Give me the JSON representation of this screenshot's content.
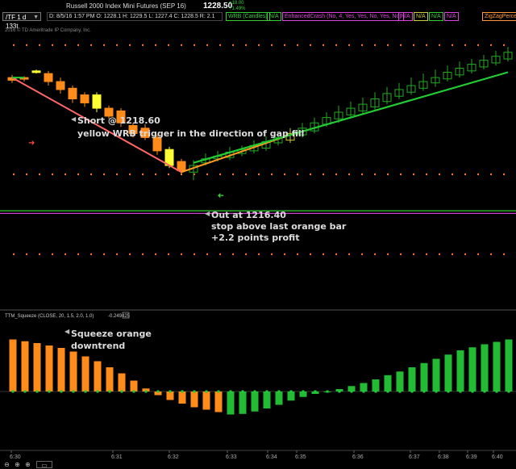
{
  "header": {
    "title_main": "Russell 2000 Index Mini Futures (SEP 16)",
    "last_price": "1228.50",
    "change": "+18.00",
    "change_pct": "+1.49%",
    "symbol": "/TF",
    "timeframe": "/TF 1 d 133t",
    "ohlc": "D: 8/5/16 1:57 PM   O: 1228.1   H: 1229.5   L: 1227.4   C: 1228.5   R: 2.1",
    "studies": [
      {
        "label": "WRB (Candles)",
        "color": "#33cc33"
      },
      {
        "label": "N/A",
        "color": "#33cc33"
      },
      {
        "label": "EnhancedCrash (No, 4, Yes, Yes, No, Yes, No)",
        "color": "#e040e0"
      },
      {
        "label": "N/A",
        "color": "#e040e0"
      },
      {
        "label": "N/A",
        "color": "#cccc33"
      },
      {
        "label": "N/A",
        "color": "#33cc33"
      },
      {
        "label": "N/A",
        "color": "#e040e0"
      },
      {
        "label": "ZigZagPerce",
        "color": "#ff9933"
      }
    ],
    "copyright": "2016 © TD Ameritrade IP Company, Inc."
  },
  "annotations": {
    "short": "Short @ 1218.60",
    "wrb": "yellow WRB trigger in the direction of gap fill",
    "out": "Out at 1216.40",
    "stop": "stop above last orange bar",
    "profit": "+2.2 points profit",
    "squeeze": "Squeeze orange",
    "downtrend": "downtrend"
  },
  "lower_panel": {
    "label": "TTM_Squeeze (CLOSE, 20, 1.5, 2.0, 1.0)",
    "value": "-0.249425"
  },
  "time_axis": [
    "6:30",
    "6:31",
    "6:32",
    "6:33",
    "6:34",
    "6:35",
    "6:36",
    "6:37",
    "6:38",
    "6:39",
    "6:40"
  ],
  "icons": [
    "zoom-out-icon",
    "search-icon",
    "zoom-in-icon",
    "menu-icon"
  ],
  "colors": {
    "orange": "#ff8c1a",
    "yellow": "#ffff33",
    "green": "#22bb33",
    "zigzag_down": "#ff6666",
    "zigzag_up": "#ff9922",
    "dots": "#ff7733"
  },
  "chart_data": {
    "type": "candlestick",
    "upper": {
      "candles": [
        {
          "o": 0.82,
          "c": 0.83,
          "h": 0.84,
          "l": 0.81,
          "t": "flat"
        },
        {
          "o": 0.825,
          "c": 0.83,
          "h": 0.835,
          "l": 0.815,
          "t": "flat"
        },
        {
          "o": 0.855,
          "c": 0.85,
          "h": 0.86,
          "l": 0.845,
          "t": "yellow"
        },
        {
          "o": 0.845,
          "c": 0.815,
          "h": 0.855,
          "l": 0.8,
          "t": "orange"
        },
        {
          "o": 0.815,
          "c": 0.785,
          "h": 0.83,
          "l": 0.77,
          "t": "orange"
        },
        {
          "o": 0.79,
          "c": 0.75,
          "h": 0.8,
          "l": 0.735,
          "t": "orange"
        },
        {
          "o": 0.765,
          "c": 0.735,
          "h": 0.775,
          "l": 0.72,
          "t": "flat"
        },
        {
          "o": 0.765,
          "c": 0.715,
          "h": 0.775,
          "l": 0.7,
          "t": "yellow"
        },
        {
          "o": 0.715,
          "c": 0.685,
          "h": 0.725,
          "l": 0.675,
          "t": "orange"
        },
        {
          "o": 0.705,
          "c": 0.66,
          "h": 0.715,
          "l": 0.645,
          "t": "orange"
        },
        {
          "o": 0.65,
          "c": 0.62,
          "h": 0.66,
          "l": 0.605,
          "t": "orange"
        },
        {
          "o": 0.64,
          "c": 0.605,
          "h": 0.655,
          "l": 0.595,
          "t": "orange"
        },
        {
          "o": 0.605,
          "c": 0.555,
          "h": 0.615,
          "l": 0.54,
          "t": "orange"
        },
        {
          "o": 0.56,
          "c": 0.5,
          "h": 0.57,
          "l": 0.49,
          "t": "yellow"
        },
        {
          "o": 0.515,
          "c": 0.48,
          "h": 0.525,
          "l": 0.465,
          "t": "orange"
        },
        {
          "o": 0.475,
          "c": 0.5,
          "h": 0.52,
          "l": 0.445,
          "t": "up"
        },
        {
          "o": 0.51,
          "c": 0.525,
          "h": 0.545,
          "l": 0.5,
          "t": "up"
        },
        {
          "o": 0.525,
          "c": 0.535,
          "h": 0.555,
          "l": 0.515,
          "t": "up"
        },
        {
          "o": 0.53,
          "c": 0.55,
          "h": 0.57,
          "l": 0.52,
          "t": "up"
        },
        {
          "o": 0.545,
          "c": 0.56,
          "h": 0.575,
          "l": 0.535,
          "t": "up"
        },
        {
          "o": 0.555,
          "c": 0.575,
          "h": 0.595,
          "l": 0.545,
          "t": "up"
        },
        {
          "o": 0.565,
          "c": 0.59,
          "h": 0.61,
          "l": 0.555,
          "t": "up"
        },
        {
          "o": 0.585,
          "c": 0.605,
          "h": 0.625,
          "l": 0.575,
          "t": "up"
        },
        {
          "o": 0.595,
          "c": 0.62,
          "h": 0.64,
          "l": 0.585,
          "t": "upy"
        },
        {
          "o": 0.615,
          "c": 0.64,
          "h": 0.66,
          "l": 0.605,
          "t": "up"
        },
        {
          "o": 0.63,
          "c": 0.66,
          "h": 0.68,
          "l": 0.62,
          "t": "up"
        },
        {
          "o": 0.655,
          "c": 0.68,
          "h": 0.7,
          "l": 0.645,
          "t": "up"
        },
        {
          "o": 0.675,
          "c": 0.7,
          "h": 0.725,
          "l": 0.66,
          "t": "up"
        },
        {
          "o": 0.69,
          "c": 0.715,
          "h": 0.74,
          "l": 0.68,
          "t": "up"
        },
        {
          "o": 0.705,
          "c": 0.73,
          "h": 0.755,
          "l": 0.695,
          "t": "up"
        },
        {
          "o": 0.72,
          "c": 0.75,
          "h": 0.775,
          "l": 0.71,
          "t": "up"
        },
        {
          "o": 0.74,
          "c": 0.77,
          "h": 0.795,
          "l": 0.73,
          "t": "up"
        },
        {
          "o": 0.76,
          "c": 0.785,
          "h": 0.81,
          "l": 0.75,
          "t": "up"
        },
        {
          "o": 0.775,
          "c": 0.8,
          "h": 0.83,
          "l": 0.765,
          "t": "up"
        },
        {
          "o": 0.79,
          "c": 0.815,
          "h": 0.845,
          "l": 0.78,
          "t": "up"
        },
        {
          "o": 0.81,
          "c": 0.83,
          "h": 0.86,
          "l": 0.795,
          "t": "up"
        },
        {
          "o": 0.825,
          "c": 0.85,
          "h": 0.875,
          "l": 0.815,
          "t": "up"
        },
        {
          "o": 0.84,
          "c": 0.865,
          "h": 0.89,
          "l": 0.83,
          "t": "up"
        },
        {
          "o": 0.855,
          "c": 0.88,
          "h": 0.9,
          "l": 0.845,
          "t": "up"
        },
        {
          "o": 0.87,
          "c": 0.895,
          "h": 0.915,
          "l": 0.86,
          "t": "up"
        },
        {
          "o": 0.885,
          "c": 0.91,
          "h": 0.93,
          "l": 0.875,
          "t": "up"
        },
        {
          "o": 0.9,
          "c": 0.925,
          "h": 0.945,
          "l": 0.89,
          "t": "up"
        }
      ],
      "zigzag_down": [
        [
          0,
          0.83
        ],
        [
          14,
          0.475
        ]
      ],
      "zigzag_up": [
        [
          14,
          0.475
        ],
        [
          23,
          0.615
        ]
      ],
      "trend_line": [
        [
          15,
          0.51
        ],
        [
          41,
          0.85
        ]
      ],
      "orange_dot_levels": [
        0.955,
        0.47,
        0.17
      ],
      "level_lines": [
        0.33,
        0.32
      ]
    },
    "lower": {
      "values": [
        0.86,
        0.83,
        0.8,
        0.76,
        0.72,
        0.66,
        0.58,
        0.5,
        0.4,
        0.3,
        0.18,
        0.05,
        -0.06,
        -0.14,
        -0.2,
        -0.26,
        -0.3,
        -0.34,
        -0.38,
        -0.37,
        -0.33,
        -0.28,
        -0.22,
        -0.15,
        -0.09,
        -0.04,
        0.0,
        0.04,
        0.09,
        0.14,
        0.2,
        0.27,
        0.33,
        0.4,
        0.47,
        0.54,
        0.61,
        0.68,
        0.73,
        0.78,
        0.82,
        0.86
      ],
      "orange_until": 17,
      "dark_orange_from": 11
    }
  }
}
